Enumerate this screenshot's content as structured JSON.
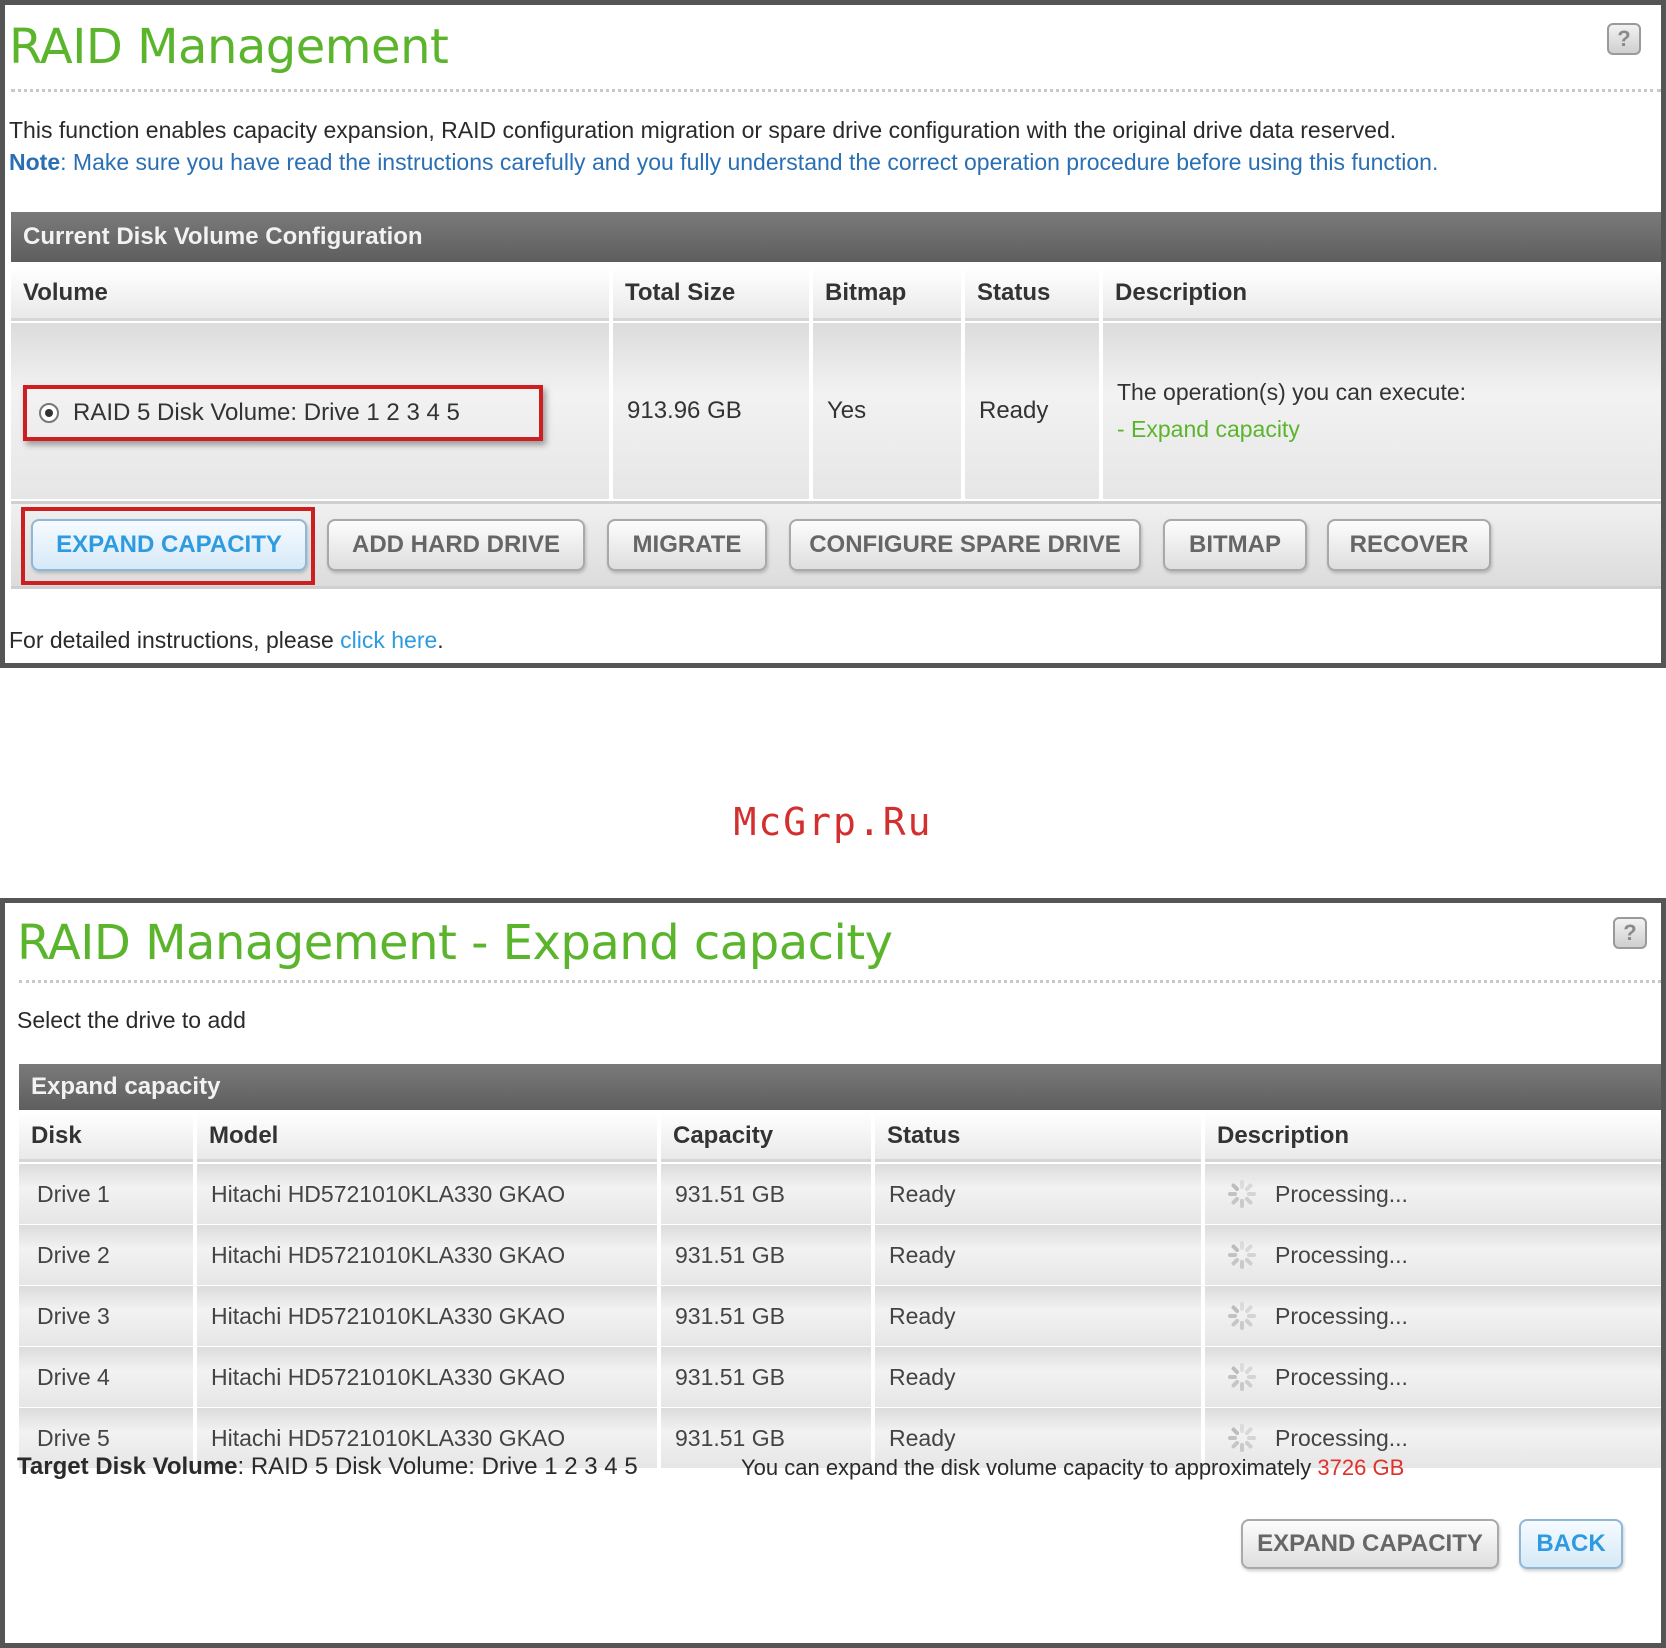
{
  "panel1": {
    "title": "RAID Management",
    "intro": "This function enables capacity expansion, RAID configuration migration or spare drive configuration with the original drive data reserved.",
    "note_label": "Note",
    "note_text": ": Make sure you have read the instructions carefully and you fully understand the correct operation procedure before using this function.",
    "section_header": "Current Disk Volume Configuration",
    "columns": [
      "Volume",
      "Total Size",
      "Bitmap",
      "Status",
      "Description"
    ],
    "row": {
      "volume": "RAID 5 Disk Volume: Drive  1 2 3 4 5",
      "total_size": "913.96 GB",
      "bitmap": "Yes",
      "status": "Ready",
      "description_line1": "The operation(s) you can execute:",
      "description_line2": "- Expand capacity"
    },
    "buttons": [
      "EXPAND CAPACITY",
      "ADD HARD DRIVE",
      "MIGRATE",
      "CONFIGURE SPARE DRIVE",
      "BITMAP",
      "RECOVER"
    ],
    "footer_prefix": "For detailed instructions, please ",
    "footer_link": "click here",
    "footer_suffix": "."
  },
  "watermark": "McGrp.Ru",
  "panel2": {
    "title": "RAID Management - Expand capacity",
    "subtitle": "Select the drive to add",
    "section_header": "Expand capacity",
    "columns": [
      "Disk",
      "Model",
      "Capacity",
      "Status",
      "Description"
    ],
    "rows": [
      {
        "disk": "Drive 1",
        "model": "Hitachi HD5721010KLA330 GKAO",
        "capacity": "931.51 GB",
        "status": "Ready",
        "description": "Processing..."
      },
      {
        "disk": "Drive 2",
        "model": "Hitachi HD5721010KLA330 GKAO",
        "capacity": "931.51 GB",
        "status": "Ready",
        "description": "Processing..."
      },
      {
        "disk": "Drive 3",
        "model": "Hitachi HD5721010KLA330 GKAO",
        "capacity": "931.51 GB",
        "status": "Ready",
        "description": "Processing..."
      },
      {
        "disk": "Drive 4",
        "model": "Hitachi HD5721010KLA330 GKAO",
        "capacity": "931.51 GB",
        "status": "Ready",
        "description": "Processing..."
      },
      {
        "disk": "Drive 5",
        "model": "Hitachi HD5721010KLA330 GKAO",
        "capacity": "931.51 GB",
        "status": "Ready",
        "description": "Processing..."
      }
    ],
    "target_label": "Target Disk Volume",
    "target_value": ": RAID 5 Disk Volume: Drive  1 2 3 4 5",
    "expand_note": "You can expand the disk volume capacity to approximately ",
    "expand_value": "3726 GB",
    "buttons": {
      "expand": "EXPAND CAPACITY",
      "back": "BACK"
    }
  },
  "colors": {
    "title_green": "#5bb52c",
    "link_blue": "#2e9ae0",
    "note_blue": "#2a6fb3",
    "highlight_red": "#cc1f1f",
    "value_red": "#e0302a"
  },
  "icons": {
    "help": "help-icon",
    "radio": "radio-selected-icon",
    "spinner": "spinner-icon"
  }
}
